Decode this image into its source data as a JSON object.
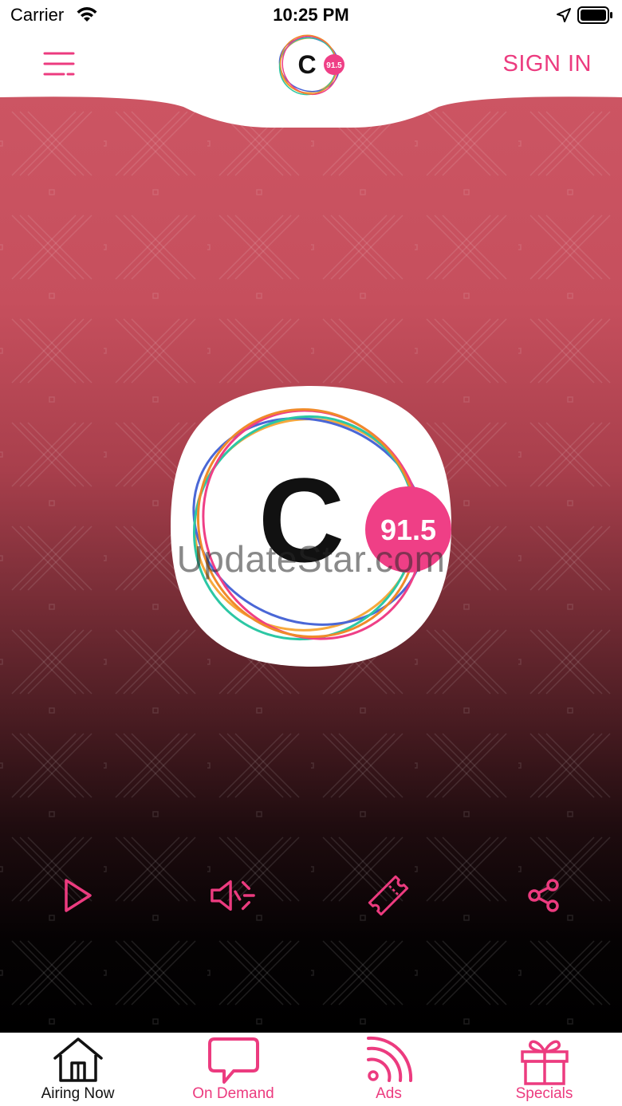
{
  "status_bar": {
    "carrier": "Carrier",
    "time": "10:25 PM"
  },
  "header": {
    "sign_in_label": "SIGN IN",
    "logo": {
      "letter": "C",
      "frequency": "91.5"
    }
  },
  "station": {
    "letter": "C",
    "frequency": "91.5"
  },
  "watermark": "UpdateStar.com",
  "controls": {
    "play_icon": "play-icon",
    "volume_icon": "volume-icon",
    "ticket_icon": "ticket-icon",
    "share_icon": "share-icon"
  },
  "tabs": [
    {
      "label": "Airing Now",
      "icon": "home-icon",
      "active": true
    },
    {
      "label": "On Demand",
      "icon": "chat-bubble-icon",
      "active": false
    },
    {
      "label": "Ads",
      "icon": "rss-icon",
      "active": false
    },
    {
      "label": "Specials",
      "icon": "gift-icon",
      "active": false
    }
  ],
  "colors": {
    "accent": "#ec3b7f",
    "hero_top": "#cc5563",
    "hero_bottom": "#000000"
  }
}
